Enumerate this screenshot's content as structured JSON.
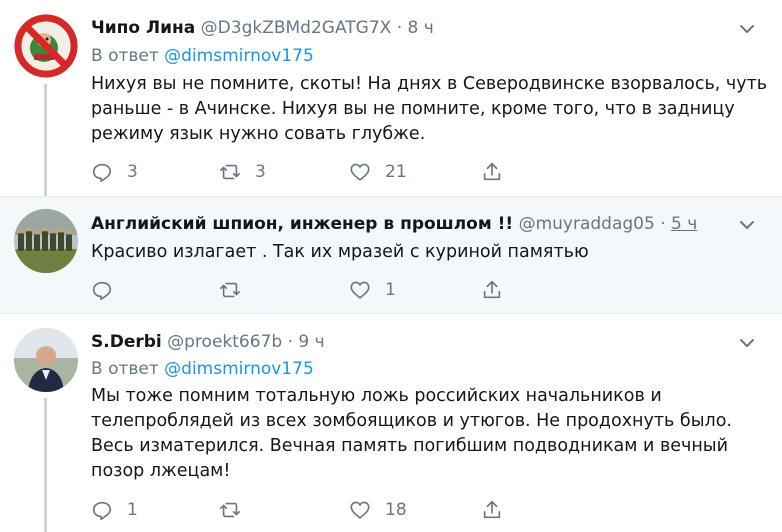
{
  "colors": {
    "accent": "#1b95e0",
    "muted": "#657786",
    "text": "#14171a",
    "thread_line": "#ccd6dd",
    "highlight_bg": "#f5f8fa"
  },
  "tweets": [
    {
      "name": "Чипо Лина",
      "handle": "@D3gkZBMd2GATG7X",
      "dot": "·",
      "time": "8 ч",
      "reply_prefix": "В ответ",
      "reply_mention": "@dimsmirnov175",
      "text_lines": [
        "Нихуя вы не помните, скоты! На днях в Северодвинске взорвалось, чуть",
        "раньше - в Ачинске. Нихуя вы не помните, кроме того, что в задницу",
        "режиму язык нужно совать глубже."
      ],
      "replies": "3",
      "retweets": "3",
      "likes": "21",
      "avatar_icon": "no-symbol-avatar-icon"
    },
    {
      "name": "Английский шпион, инженер в прошлом !!",
      "handle": "@muyraddag05",
      "dot": "·",
      "time": "5 ч",
      "text_lines": [
        "Красиво излагает . Так их мразей с куриной памятью"
      ],
      "replies": "",
      "retweets": "",
      "likes": "1",
      "avatar_icon": "group-photo-avatar-icon"
    },
    {
      "name": "S.Derbi",
      "handle": "@proekt667b",
      "dot": "·",
      "time": "9 ч",
      "reply_prefix": "В ответ",
      "reply_mention": "@dimsmirnov175",
      "text_lines": [
        "Мы тоже помним тотальную ложь российских начальников и",
        "телепроблядей из всех зомбоящиков и утюгов. Не продохнуть было.",
        "Весь изматерился. Вечная память погибшим подводникам и вечный",
        "позор лжецам!"
      ],
      "replies": "1",
      "retweets": "",
      "likes": "18",
      "avatar_icon": "man-portrait-avatar-icon"
    }
  ]
}
